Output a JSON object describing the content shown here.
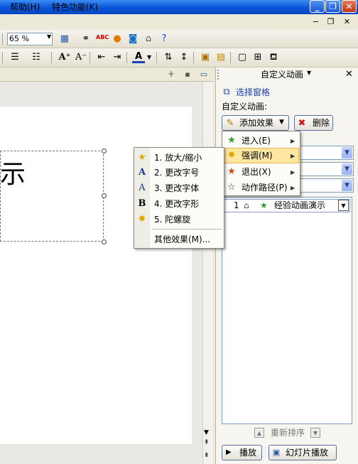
{
  "colors": {
    "titlebar": "#0a55d9",
    "highlight": "#ffe7a2",
    "taskpane": "#f6f5ef"
  },
  "menubar": {
    "help": "帮助(H)",
    "special": "特色功能(K)"
  },
  "toolbar": {
    "zoom_value": "65 %"
  },
  "slide": {
    "visible_text": "示"
  },
  "taskpane": {
    "title": "自定义动画",
    "select_pane": "选择窗格",
    "section_label": "自定义动画:",
    "add_effect": "添加效果",
    "delete": "删除",
    "list_item": {
      "index": "1",
      "name": "经验动画演示"
    },
    "reorder": "重新排序",
    "play": "播放",
    "slideshow": "幻灯片播放"
  },
  "effect_menu": [
    {
      "label": "进入(E)",
      "icon": "green-star-icon"
    },
    {
      "label": "强调(M)",
      "icon": "yellow-star-icon",
      "highlighted": true
    },
    {
      "label": "退出(X)",
      "icon": "red-star-icon"
    },
    {
      "label": "动作路径(P)",
      "icon": "outline-star-icon"
    }
  ],
  "emphasis_menu": [
    {
      "label": "1. 放大/缩小",
      "icon": "grow-shrink-icon"
    },
    {
      "label": "2. 更改字号",
      "icon": "font-size-icon"
    },
    {
      "label": "3. 更改字体",
      "icon": "font-icon"
    },
    {
      "label": "4. 更改字形",
      "icon": "bold-icon"
    },
    {
      "label": "5. 陀螺旋",
      "icon": "spin-icon"
    }
  ],
  "emphasis_more": "其他效果(M)..."
}
